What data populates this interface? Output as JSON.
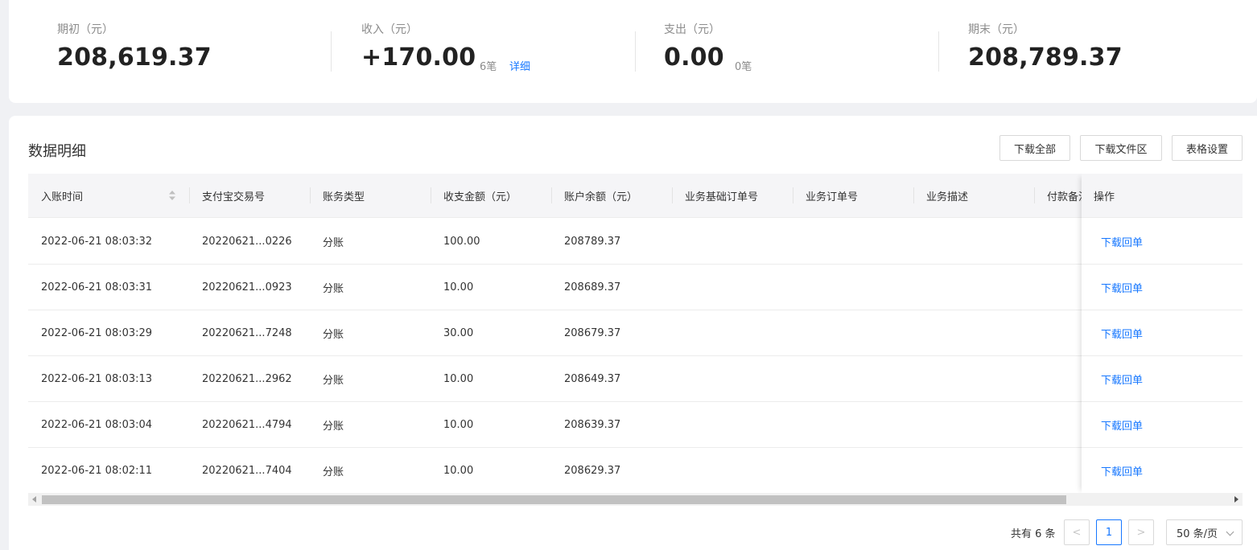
{
  "summary": {
    "opening": {
      "label": "期初（元）",
      "value": "208,619.37"
    },
    "income": {
      "label": "收入（元）",
      "value": "+170.00",
      "count": "6笔",
      "detail_link": "详细"
    },
    "expense": {
      "label": "支出（元）",
      "value": "0.00",
      "count": "0笔"
    },
    "closing": {
      "label": "期末（元）",
      "value": "208,789.37"
    }
  },
  "section": {
    "title": "数据明细"
  },
  "toolbar": {
    "download_all": "下载全部",
    "download_files": "下载文件区",
    "table_settings": "表格设置"
  },
  "table": {
    "columns": [
      "入账时间",
      "支付宝交易号",
      "账务类型",
      "收支金额（元）",
      "账户余额（元）",
      "业务基础订单号",
      "业务订单号",
      "业务描述",
      "付款备注"
    ],
    "action_header": "操作",
    "action_label": "下载回单",
    "rows": [
      {
        "time": "2022-06-21 08:03:32",
        "trade_no": "20220621...0226",
        "type": "分账",
        "amount": "100.00",
        "balance": "208789.37"
      },
      {
        "time": "2022-06-21 08:03:31",
        "trade_no": "20220621...0923",
        "type": "分账",
        "amount": "10.00",
        "balance": "208689.37"
      },
      {
        "time": "2022-06-21 08:03:29",
        "trade_no": "20220621...7248",
        "type": "分账",
        "amount": "30.00",
        "balance": "208679.37"
      },
      {
        "time": "2022-06-21 08:03:13",
        "trade_no": "20220621...2962",
        "type": "分账",
        "amount": "10.00",
        "balance": "208649.37"
      },
      {
        "time": "2022-06-21 08:03:04",
        "trade_no": "20220621...4794",
        "type": "分账",
        "amount": "10.00",
        "balance": "208639.37"
      },
      {
        "time": "2022-06-21 08:02:11",
        "trade_no": "20220621...7404",
        "type": "分账",
        "amount": "10.00",
        "balance": "208629.37"
      }
    ]
  },
  "pagination": {
    "total": "共有 6 条",
    "prev": "<",
    "page": "1",
    "next": ">",
    "page_size": "50 条/页"
  },
  "colors": {
    "link": "#1677ff",
    "header_bg": "#f5f5f7",
    "page_bg": "#f0f1f4"
  },
  "icons": {
    "sort": "sort-icon",
    "scroll_left": "arrow-left-icon",
    "scroll_right": "arrow-right-icon",
    "dropdown": "chevron-down-icon"
  }
}
